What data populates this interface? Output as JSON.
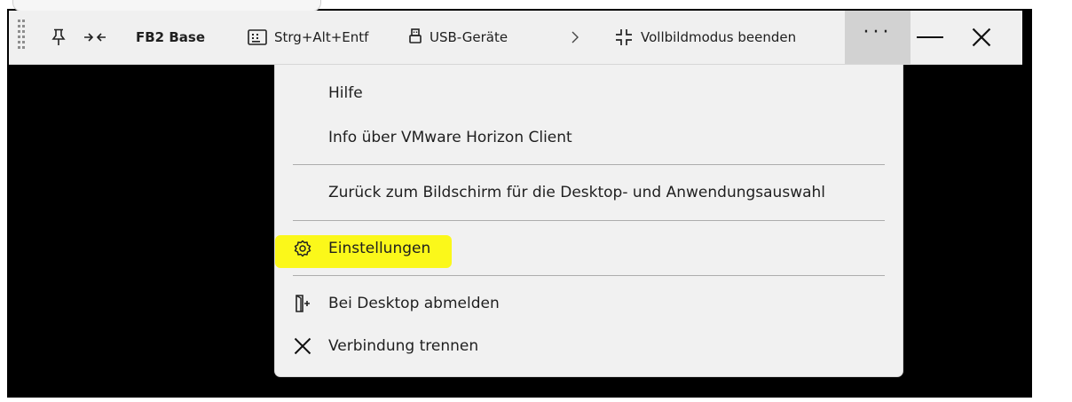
{
  "toolbar": {
    "connection_name": "FB2 Base",
    "ctrl_alt_del": "Strg+Alt+Entf",
    "usb_devices": "USB-Geräte",
    "exit_fullscreen": "Vollbildmodus beenden",
    "more_label": "···",
    "icons": [
      "pin-icon",
      "shrink-icon",
      "keyboard-icon",
      "usb-icon",
      "chevron-right-icon",
      "exit-fullscreen-icon",
      "minimize-icon",
      "close-icon"
    ]
  },
  "menu": {
    "items": [
      {
        "label": "Hilfe",
        "icon": ""
      },
      {
        "label": "Info über VMware Horizon Client",
        "icon": ""
      },
      {
        "label": "Zurück zum Bildschirm für die Desktop- und Anwendungsauswahl",
        "icon": ""
      },
      {
        "label": "Einstellungen",
        "icon": "gear-icon",
        "highlighted": true
      },
      {
        "label": "Bei Desktop abmelden",
        "icon": "logout-icon"
      },
      {
        "label": "Verbindung trennen",
        "icon": "close-icon"
      }
    ],
    "highlight_color": "#fbf81a"
  },
  "colors": {
    "toolbar_bg": "#f0f0f0",
    "menu_bg": "#f1f1f1",
    "background": "#000000"
  }
}
